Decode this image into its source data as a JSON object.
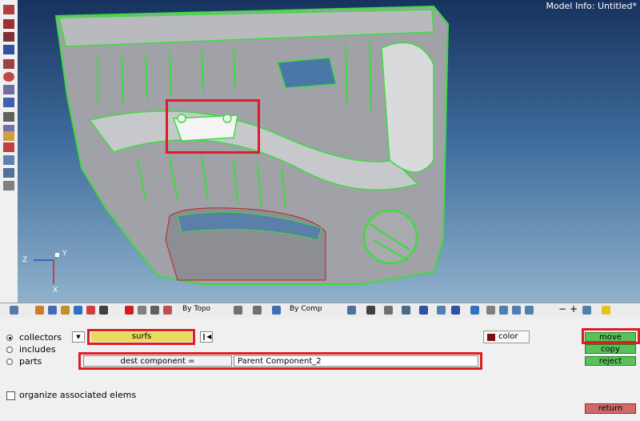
{
  "viewport": {
    "model_info": "Model Info: Untitled*",
    "axes": {
      "x": "X",
      "y": "Y",
      "z": "Z"
    }
  },
  "toolbar": {
    "by_topo_label": "By Topo",
    "by_comp_label": "By Comp"
  },
  "panel": {
    "radio_collectors": "collectors",
    "radio_includes": "includes",
    "radio_parts": "parts",
    "collector_value": "surfs",
    "color_label": "color",
    "dest_component_label": "dest component =",
    "dest_component_value": "Parent Component_2",
    "organize_label": "organize associated elems",
    "move_label": "move",
    "copy_label": "copy",
    "reject_label": "reject",
    "return_label": "return"
  },
  "colors": {
    "highlight_red": "#dd1c24",
    "surfs_yellow": "#e8dc5a",
    "button_green": "#58c258",
    "return_red": "#d06a6a",
    "color_swatch": "#7a1010",
    "mesh_green": "#3ddc3d"
  }
}
